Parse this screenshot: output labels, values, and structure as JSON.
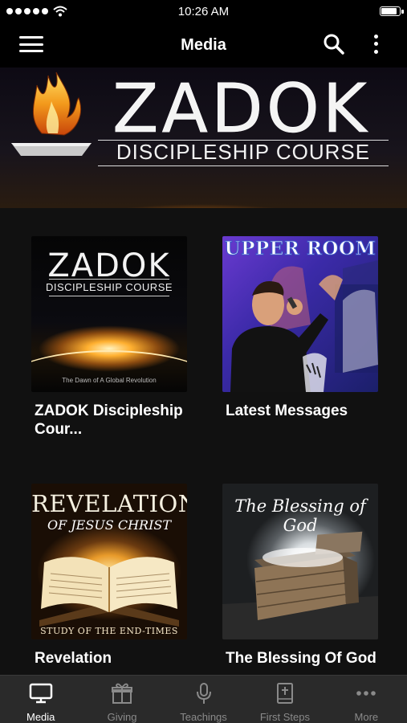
{
  "status_bar": {
    "time": "10:26 AM"
  },
  "nav": {
    "title": "Media"
  },
  "banner": {
    "title": "ZADOK",
    "subtitle": "DISCIPLESHIP COURSE"
  },
  "grid": [
    {
      "label": "ZADOK Discipleship Cour...",
      "art_title": "ZADOK",
      "art_subtitle": "DISCIPLESHIP COURSE",
      "art_footer": "The Dawn of A Global Revolution"
    },
    {
      "label": "Latest Messages",
      "art_title": "UPPER ROOM"
    },
    {
      "label": "Revelation",
      "art_title": "REVELATION",
      "art_subtitle": "OF JESUS CHRIST",
      "art_footer": "STUDY OF THE END-TIMES"
    },
    {
      "label": "The Blessing Of God",
      "art_title": "The Blessing of God"
    }
  ],
  "tabs": [
    {
      "label": "Media",
      "icon": "tv-icon",
      "active": true
    },
    {
      "label": "Giving",
      "icon": "gift-icon",
      "active": false
    },
    {
      "label": "Teachings",
      "icon": "microphone-icon",
      "active": false
    },
    {
      "label": "First Steps",
      "icon": "bible-icon",
      "active": false
    },
    {
      "label": "More",
      "icon": "ellipsis-icon",
      "active": false
    }
  ],
  "colors": {
    "background": "#111111",
    "bar": "#000000",
    "tab_bar": "#2a2a2a",
    "tab_active": "#ffffff",
    "tab_inactive": "#8a8a8a"
  }
}
